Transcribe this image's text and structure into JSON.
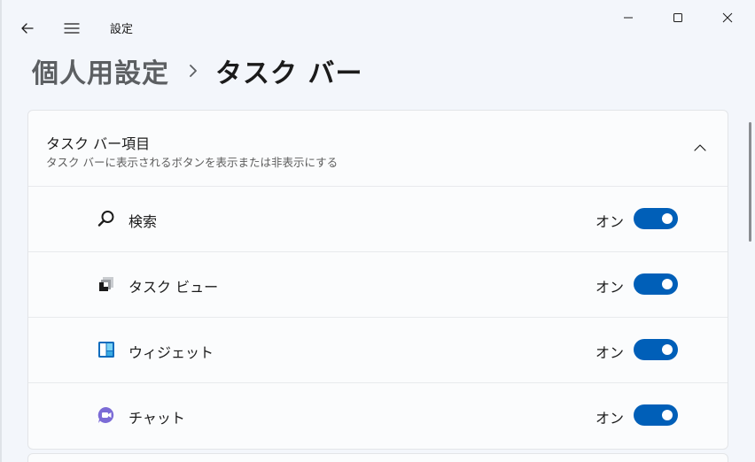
{
  "window": {
    "app_title": "設定",
    "back_icon": "back-arrow-icon",
    "menu_icon": "hamburger-menu-icon",
    "controls": [
      "minimize-icon",
      "maximize-icon",
      "close-icon"
    ]
  },
  "breadcrumb": {
    "parent": "個人用設定",
    "separator": "›",
    "current": "タスク バー"
  },
  "section": {
    "title": "タスク バー項目",
    "subtitle": "タスク バーに表示されるボタンを表示または非表示にする",
    "expanded": true,
    "items": [
      {
        "label": "検索",
        "state": "オン",
        "on": true,
        "icon": "search-icon"
      },
      {
        "label": "タスク ビュー",
        "state": "オン",
        "on": true,
        "icon": "task-view-icon"
      },
      {
        "label": "ウィジェット",
        "state": "オン",
        "on": true,
        "icon": "widgets-icon"
      },
      {
        "label": "チャット",
        "state": "オン",
        "on": true,
        "icon": "chat-icon"
      }
    ]
  },
  "colors": {
    "accent": "#005fb8",
    "window_bg": "#f3f6fb",
    "card_bg": "#fbfcfd",
    "chat_icon": "#7b6bd6",
    "widgets_icon": "#1aa3d9"
  }
}
